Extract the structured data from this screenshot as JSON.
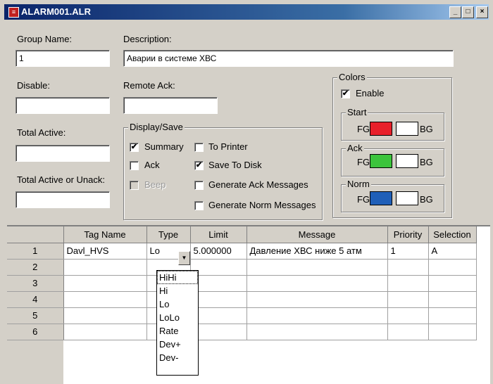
{
  "window": {
    "title": "ALARM001.ALR",
    "min_label": "_",
    "max_label": "□",
    "close_label": "×"
  },
  "form": {
    "group_name_label": "Group Name:",
    "group_name_value": "1",
    "description_label": "Description:",
    "description_value": "Аварии в системе ХВС",
    "disable_label": "Disable:",
    "disable_value": "",
    "remote_ack_label": "Remote Ack:",
    "remote_ack_value": "",
    "total_active_label": "Total Active:",
    "total_active_value": "",
    "total_active_unack_label": "Total Active or Unack:",
    "total_active_unack_value": ""
  },
  "display_save": {
    "title": "Display/Save",
    "options": [
      {
        "label": "Summary",
        "checked": true,
        "enabled": true
      },
      {
        "label": "Ack",
        "checked": false,
        "enabled": true
      },
      {
        "label": "Beep",
        "checked": false,
        "enabled": false
      },
      {
        "label": "To Printer",
        "checked": false,
        "enabled": true
      },
      {
        "label": "Save To Disk",
        "checked": true,
        "enabled": true
      },
      {
        "label": "Generate Ack Messages",
        "checked": false,
        "enabled": true
      },
      {
        "label": "Generate Norm Messages",
        "checked": false,
        "enabled": true
      }
    ]
  },
  "colors": {
    "title": "Colors",
    "enable_label": "Enable",
    "enable_checked": true,
    "groups": [
      {
        "title": "Start",
        "fg_label": "FG",
        "bg_label": "BG",
        "fg_color": "#e8202a",
        "bg_color": "#ffffff"
      },
      {
        "title": "Ack",
        "fg_label": "FG",
        "bg_label": "BG",
        "fg_color": "#3cc43c",
        "bg_color": "#ffffff"
      },
      {
        "title": "Norm",
        "fg_label": "FG",
        "bg_label": "BG",
        "fg_color": "#1f5fb8",
        "bg_color": "#ffffff"
      }
    ]
  },
  "grid": {
    "columns": [
      "",
      "Tag Name",
      "Type",
      "Limit",
      "Message",
      "Priority",
      "Selection"
    ],
    "rows": [
      {
        "num": "1",
        "tag": "Davl_HVS",
        "type": "Lo",
        "limit": "5.000000",
        "message": "Давление ХВС ниже 5 атм",
        "priority": "1",
        "selection": "A"
      },
      {
        "num": "2",
        "tag": "",
        "type": "",
        "limit": "",
        "message": "",
        "priority": "",
        "selection": ""
      },
      {
        "num": "3",
        "tag": "",
        "type": "",
        "limit": "",
        "message": "",
        "priority": "",
        "selection": ""
      },
      {
        "num": "4",
        "tag": "",
        "type": "",
        "limit": "",
        "message": "",
        "priority": "",
        "selection": ""
      },
      {
        "num": "5",
        "tag": "",
        "type": "",
        "limit": "",
        "message": "",
        "priority": "",
        "selection": ""
      },
      {
        "num": "6",
        "tag": "",
        "type": "",
        "limit": "",
        "message": "",
        "priority": "",
        "selection": ""
      }
    ]
  },
  "type_dropdown": {
    "options": [
      "HiHi",
      "Hi",
      "Lo",
      "LoLo",
      "Rate",
      "Dev+",
      "Dev-"
    ],
    "highlighted": "HiHi"
  },
  "icons": {
    "app": "alarm-file-icon",
    "dropdown": "chevron-down-icon",
    "check": "checkmark-icon"
  }
}
